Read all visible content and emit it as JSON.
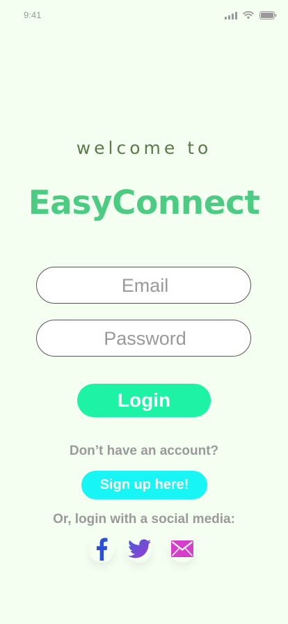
{
  "status_bar": {
    "time": "9:41",
    "icons": [
      "signal-icon",
      "wifi-icon",
      "battery-icon"
    ]
  },
  "welcome": {
    "prefix": "welcome to",
    "brand": "EasyConnect"
  },
  "form": {
    "email_placeholder": "Email",
    "email_value": "",
    "password_placeholder": "Password",
    "password_value": "",
    "login_label": "Login"
  },
  "signup": {
    "prompt": "Don’t have an account?",
    "button_label": "Sign up here!"
  },
  "social": {
    "prompt": "Or, login with a social media:",
    "items": [
      {
        "icon": "facebook-icon",
        "color": "#2a4fd3"
      },
      {
        "icon": "twitter-icon",
        "color": "#7a49d6"
      },
      {
        "icon": "email-icon",
        "color": "#d43fc9"
      }
    ]
  },
  "colors": {
    "background": "#f5fff1",
    "brand": "#4ccc82",
    "login_button": "#1ef2a4",
    "signup_button": "#17f5f5",
    "muted_text": "#9a9a9a",
    "welcome_text": "#5a7a4a"
  }
}
